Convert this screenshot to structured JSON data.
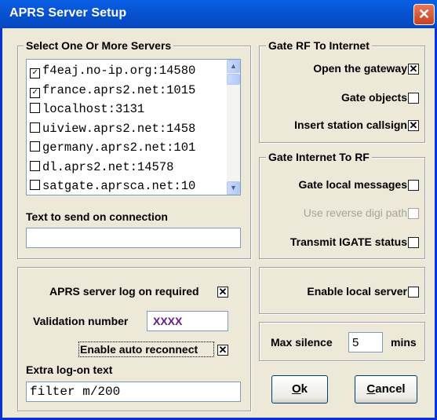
{
  "window": {
    "title": "APRS Server Setup",
    "close_glyph": "✕"
  },
  "servers": {
    "legend": "Select One Or More Servers",
    "items": [
      {
        "label": "f4eaj.no-ip.org:14580",
        "checked": true
      },
      {
        "label": "france.aprs2.net:1015",
        "checked": true
      },
      {
        "label": "localhost:3131",
        "checked": false
      },
      {
        "label": "uiview.aprs2.net:1458",
        "checked": false
      },
      {
        "label": "germany.aprs2.net:101",
        "checked": false
      },
      {
        "label": "dl.aprs2.net:14578",
        "checked": false
      },
      {
        "label": "satgate.aprsca.net:10",
        "checked": false
      }
    ],
    "scroll_up": "▲",
    "scroll_down": "▼",
    "connect_text_label": "Text to send on connection",
    "connect_text_value": ""
  },
  "gate_rf": {
    "legend": "Gate RF To Internet",
    "open_gateway": {
      "label": "Open the gateway",
      "checked": "✕"
    },
    "gate_objects": {
      "label": "Gate objects",
      "checked": ""
    },
    "insert_callsign": {
      "label": "Insert station callsign",
      "checked": "✕"
    }
  },
  "gate_inet": {
    "legend": "Gate Internet To RF",
    "local_messages": {
      "label": "Gate local messages",
      "checked": ""
    },
    "reverse_digi": {
      "label": "Use reverse digi path",
      "checked": ""
    },
    "igate_status": {
      "label": "Transmit IGATE status",
      "checked": ""
    }
  },
  "logon": {
    "log_on_required": {
      "label": "APRS server log on required",
      "checked": "✕"
    },
    "validation_label": "Validation number",
    "validation_value": "XXXX",
    "auto_reconnect": {
      "label": "Enable auto reconnect",
      "checked": "✕"
    },
    "extra_label": "Extra log-on text",
    "extra_value": "filter m/200"
  },
  "local_server": {
    "label": "Enable local server",
    "checked": ""
  },
  "silence": {
    "label": "Max silence",
    "value": "5",
    "unit": "mins"
  },
  "buttons": {
    "ok_mnemonic": "O",
    "ok_rest": "k",
    "cancel_mnemonic": "C",
    "cancel_rest": "ancel"
  }
}
